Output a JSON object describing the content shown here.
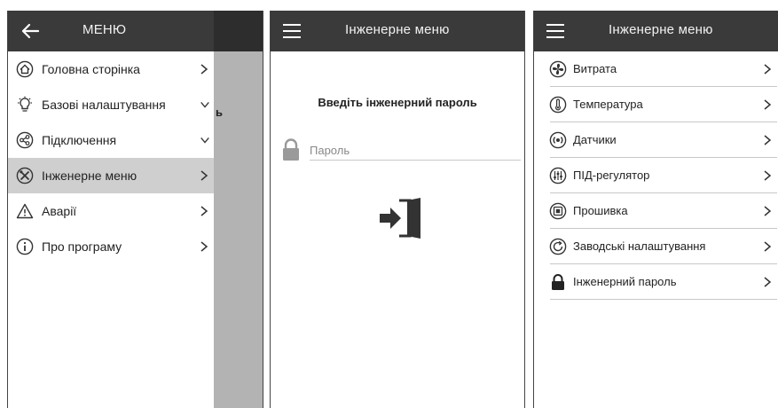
{
  "screen1": {
    "header": {
      "title": "МЕНЮ",
      "back_icon": "arrow-left-icon"
    },
    "peek_text": "ь",
    "items": [
      {
        "label": "Головна сторінка",
        "icon": "home-icon",
        "chevron": "right"
      },
      {
        "label": "Базові налаштування",
        "icon": "settings-bulb-icon",
        "chevron": "down"
      },
      {
        "label": "Підключення",
        "icon": "share-icon",
        "chevron": "down"
      },
      {
        "label": "Інженерне меню",
        "icon": "tools-icon",
        "chevron": "right",
        "active": true
      },
      {
        "label": "Аварії",
        "icon": "warning-icon",
        "chevron": "right"
      },
      {
        "label": "Про програму",
        "icon": "info-icon",
        "chevron": "right"
      }
    ]
  },
  "screen2": {
    "header": {
      "title": "Інженерне меню",
      "menu_icon": "hamburger-icon"
    },
    "prompt": "Введіть інженерний пароль",
    "password_placeholder": "Пароль",
    "submit_icon": "login-icon"
  },
  "screen3": {
    "header": {
      "title": "Інженерне меню",
      "menu_icon": "hamburger-icon"
    },
    "items": [
      {
        "label": "Витрата",
        "icon": "fan-icon"
      },
      {
        "label": "Температура",
        "icon": "thermometer-icon"
      },
      {
        "label": "Датчики",
        "icon": "sensor-icon"
      },
      {
        "label": "ПІД-регулятор",
        "icon": "regulator-icon"
      },
      {
        "label": "Прошивка",
        "icon": "chip-icon"
      },
      {
        "label": "Заводські налаштування",
        "icon": "reset-icon"
      },
      {
        "label": "Інженерний пароль",
        "icon": "lock-icon"
      }
    ]
  },
  "colors": {
    "appbar": "#3a3a3a",
    "active_item": "#cfcfcf",
    "overlay": "#b3b3b3",
    "divider": "#c8c8c8"
  }
}
